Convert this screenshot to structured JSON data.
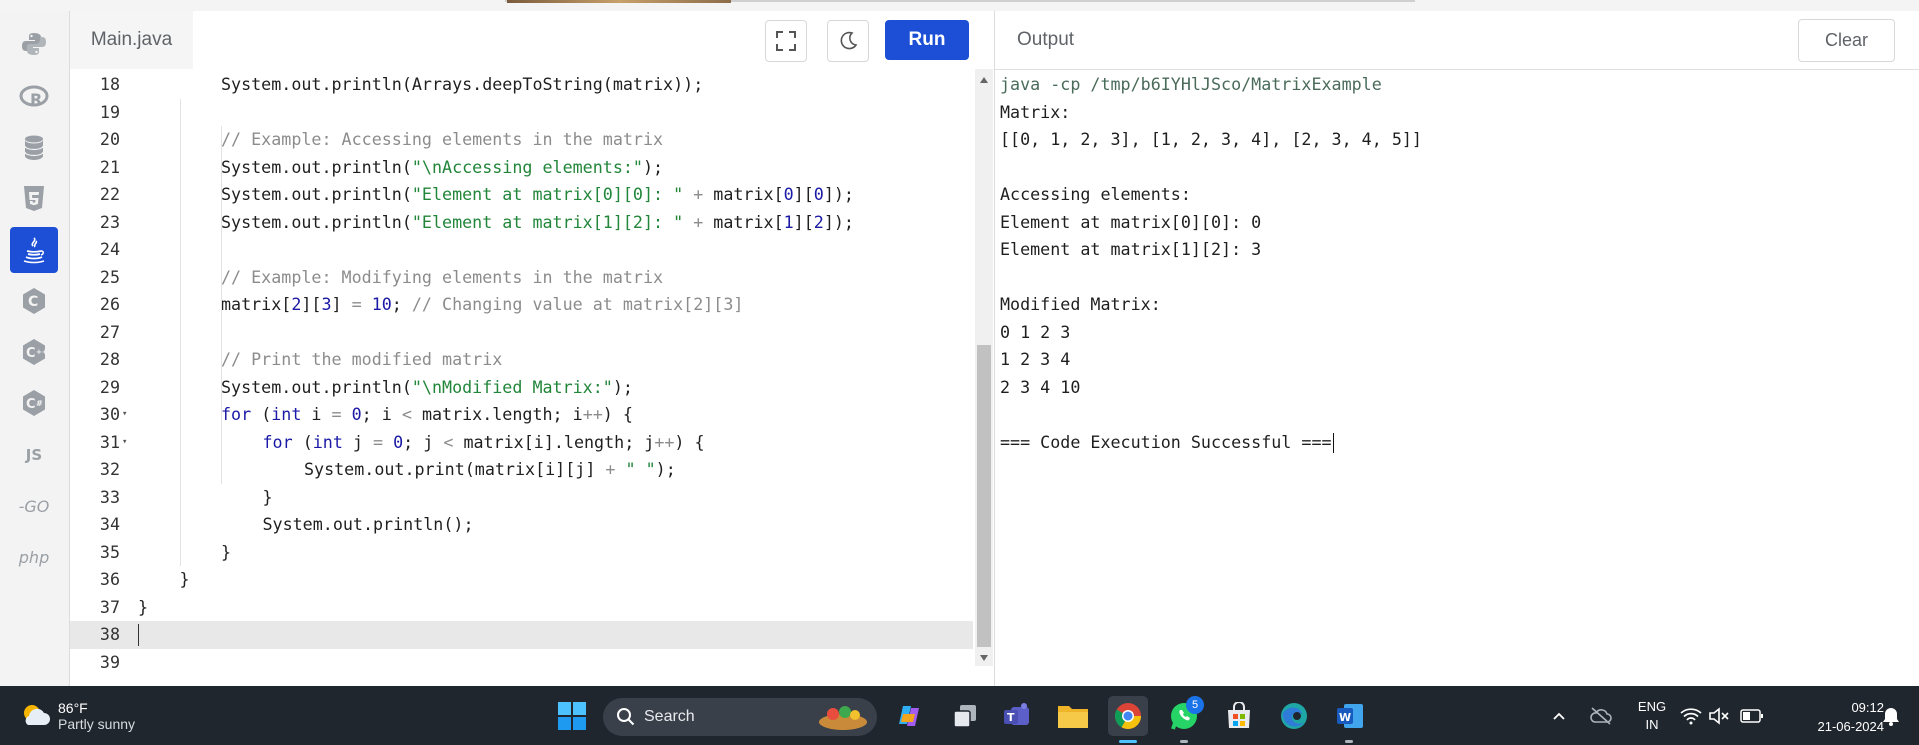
{
  "editor": {
    "file_tab": "Main.java",
    "run_label": "Run",
    "fullscreen_icon": "fullscreen-icon",
    "theme_icon": "moon-icon"
  },
  "sidebar": {
    "items": [
      {
        "name": "python",
        "icon": "python-icon"
      },
      {
        "name": "r",
        "icon": "r-icon"
      },
      {
        "name": "sql",
        "icon": "database-icon"
      },
      {
        "name": "html",
        "icon": "html5-icon"
      },
      {
        "name": "java",
        "icon": "java-icon",
        "active": true
      },
      {
        "name": "c",
        "icon": "c-icon"
      },
      {
        "name": "cpp",
        "icon": "cpp-icon"
      },
      {
        "name": "csharp",
        "icon": "csharp-icon"
      },
      {
        "name": "js",
        "label": "JS"
      },
      {
        "name": "go",
        "label": "-GO"
      },
      {
        "name": "php",
        "label": "php"
      }
    ]
  },
  "code": {
    "lines": [
      {
        "n": "18",
        "text": "System.out.println(Arrays.deepToString(matrix));"
      },
      {
        "n": "19",
        "text": ""
      },
      {
        "n": "20",
        "text": "// Example: Accessing elements in the matrix"
      },
      {
        "n": "21",
        "text": "System.out.println(\"\\nAccessing elements:\");"
      },
      {
        "n": "22",
        "text": "System.out.println(\"Element at matrix[0][0]: \" + matrix[0][0]);"
      },
      {
        "n": "23",
        "text": "System.out.println(\"Element at matrix[1][2]: \" + matrix[1][2]);"
      },
      {
        "n": "24",
        "text": ""
      },
      {
        "n": "25",
        "text": "// Example: Modifying elements in the matrix"
      },
      {
        "n": "26",
        "text": "matrix[2][3] = 10; // Changing value at matrix[2][3]"
      },
      {
        "n": "27",
        "text": ""
      },
      {
        "n": "28",
        "text": "// Print the modified matrix"
      },
      {
        "n": "29",
        "text": "System.out.println(\"\\nModified Matrix:\");"
      },
      {
        "n": "30",
        "text": "for (int i = 0; i < matrix.length; i++) {"
      },
      {
        "n": "31",
        "text": "for (int j = 0; j < matrix[i].length; j++) {"
      },
      {
        "n": "32",
        "text": "System.out.print(matrix[i][j] + \" \");"
      },
      {
        "n": "33",
        "text": "}"
      },
      {
        "n": "34",
        "text": "System.out.println();"
      },
      {
        "n": "35",
        "text": "}"
      },
      {
        "n": "36",
        "text": "}"
      },
      {
        "n": "37",
        "text": "}"
      },
      {
        "n": "38",
        "text": ""
      },
      {
        "n": "39",
        "text": ""
      }
    ]
  },
  "output": {
    "title": "Output",
    "clear_label": "Clear",
    "lines": [
      "java -cp /tmp/b6IYHlJSco/MatrixExample",
      "Matrix:",
      "[[0, 1, 2, 3], [1, 2, 3, 4], [2, 3, 4, 5]]",
      "",
      "Accessing elements:",
      "Element at matrix[0][0]: 0",
      "Element at matrix[1][2]: 3",
      "",
      "Modified Matrix:",
      "0 1 2 3 ",
      "1 2 3 4 ",
      "2 3 4 10 ",
      "",
      "=== Code Execution Successful ==="
    ]
  },
  "taskbar": {
    "weather_temp": "86°F",
    "weather_desc": "Partly sunny",
    "search_label": "Search",
    "whatsapp_badge": "5",
    "lang_line1": "ENG",
    "lang_line2": "IN",
    "time": "09:12",
    "date": "21-06-2024"
  },
  "colors": {
    "accent": "#1c4fd6",
    "taskbar": "#20262e"
  }
}
